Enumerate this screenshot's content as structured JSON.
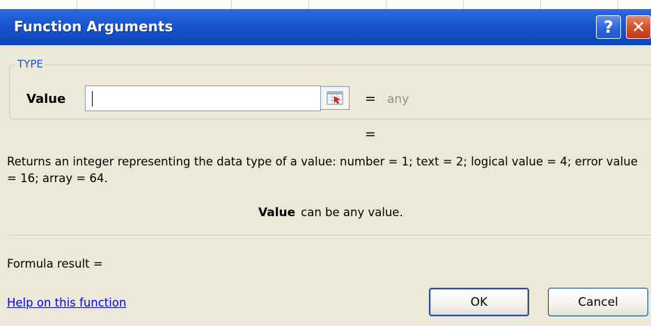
{
  "dialog": {
    "title": "Function Arguments",
    "help_button": "?",
    "close_button": "✕"
  },
  "group": {
    "label": "TYPE",
    "argument_name": "Value",
    "argument_value": "",
    "equals": "=",
    "evaluated": "any"
  },
  "result_equals": "=",
  "description": "Returns an integer representing the data type of a value: number = 1; text = 2; logical value = 4; error value = 16; array = 64.",
  "argument_help": {
    "name": "Value",
    "text": "can be any value."
  },
  "formula_result": "Formula result =",
  "help_link": "Help on this function",
  "buttons": {
    "ok": "OK",
    "cancel": "Cancel"
  },
  "icons": {
    "collapse": "collapse-dialog-icon"
  },
  "colors": {
    "titlebar": "#1550c8",
    "dialog_bg": "#ece9d8",
    "group_label": "#1a4fd0",
    "link": "#0000ee",
    "close": "#d7502c"
  }
}
